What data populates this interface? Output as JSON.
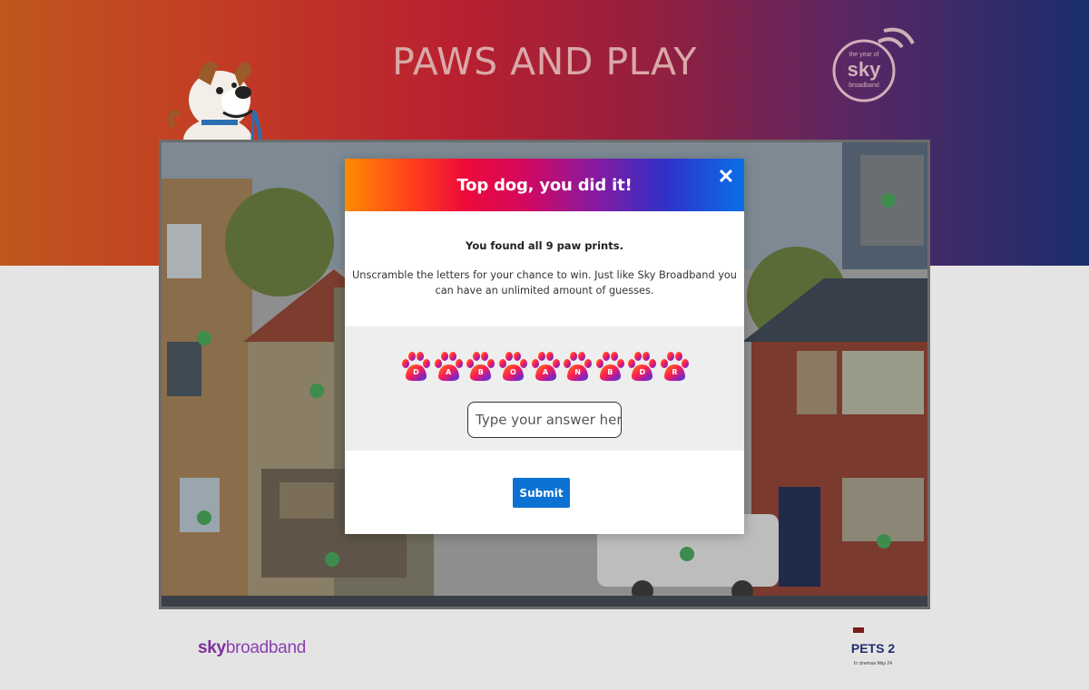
{
  "page": {
    "title": "PAWS AND PLAY",
    "roundel": {
      "line1": "the year of",
      "line2": "sky",
      "line3": "broadband"
    }
  },
  "modal": {
    "title": "Top dog, you did it!",
    "close_icon": "close-icon",
    "found_text": "You found all 9 paw prints.",
    "description": "Unscramble the letters for your chance to win. Just like Sky Broadband you can have an unlimited amount of guesses.",
    "letters": [
      "D",
      "A",
      "B",
      "O",
      "A",
      "N",
      "B",
      "D",
      "R"
    ],
    "answer_placeholder": "Type your answer here",
    "submit_label": "Submit"
  },
  "footer": {
    "sky": "sky",
    "broadband": "broadband",
    "pets_logo": "PETS 2",
    "pets_subtitle": "In cinemas May 24"
  },
  "colors": {
    "submit": "#0b72d4",
    "header_gradient": [
      "#ff8c00",
      "#ee0a3a",
      "#8a1a9e",
      "#0a6fe8"
    ]
  }
}
